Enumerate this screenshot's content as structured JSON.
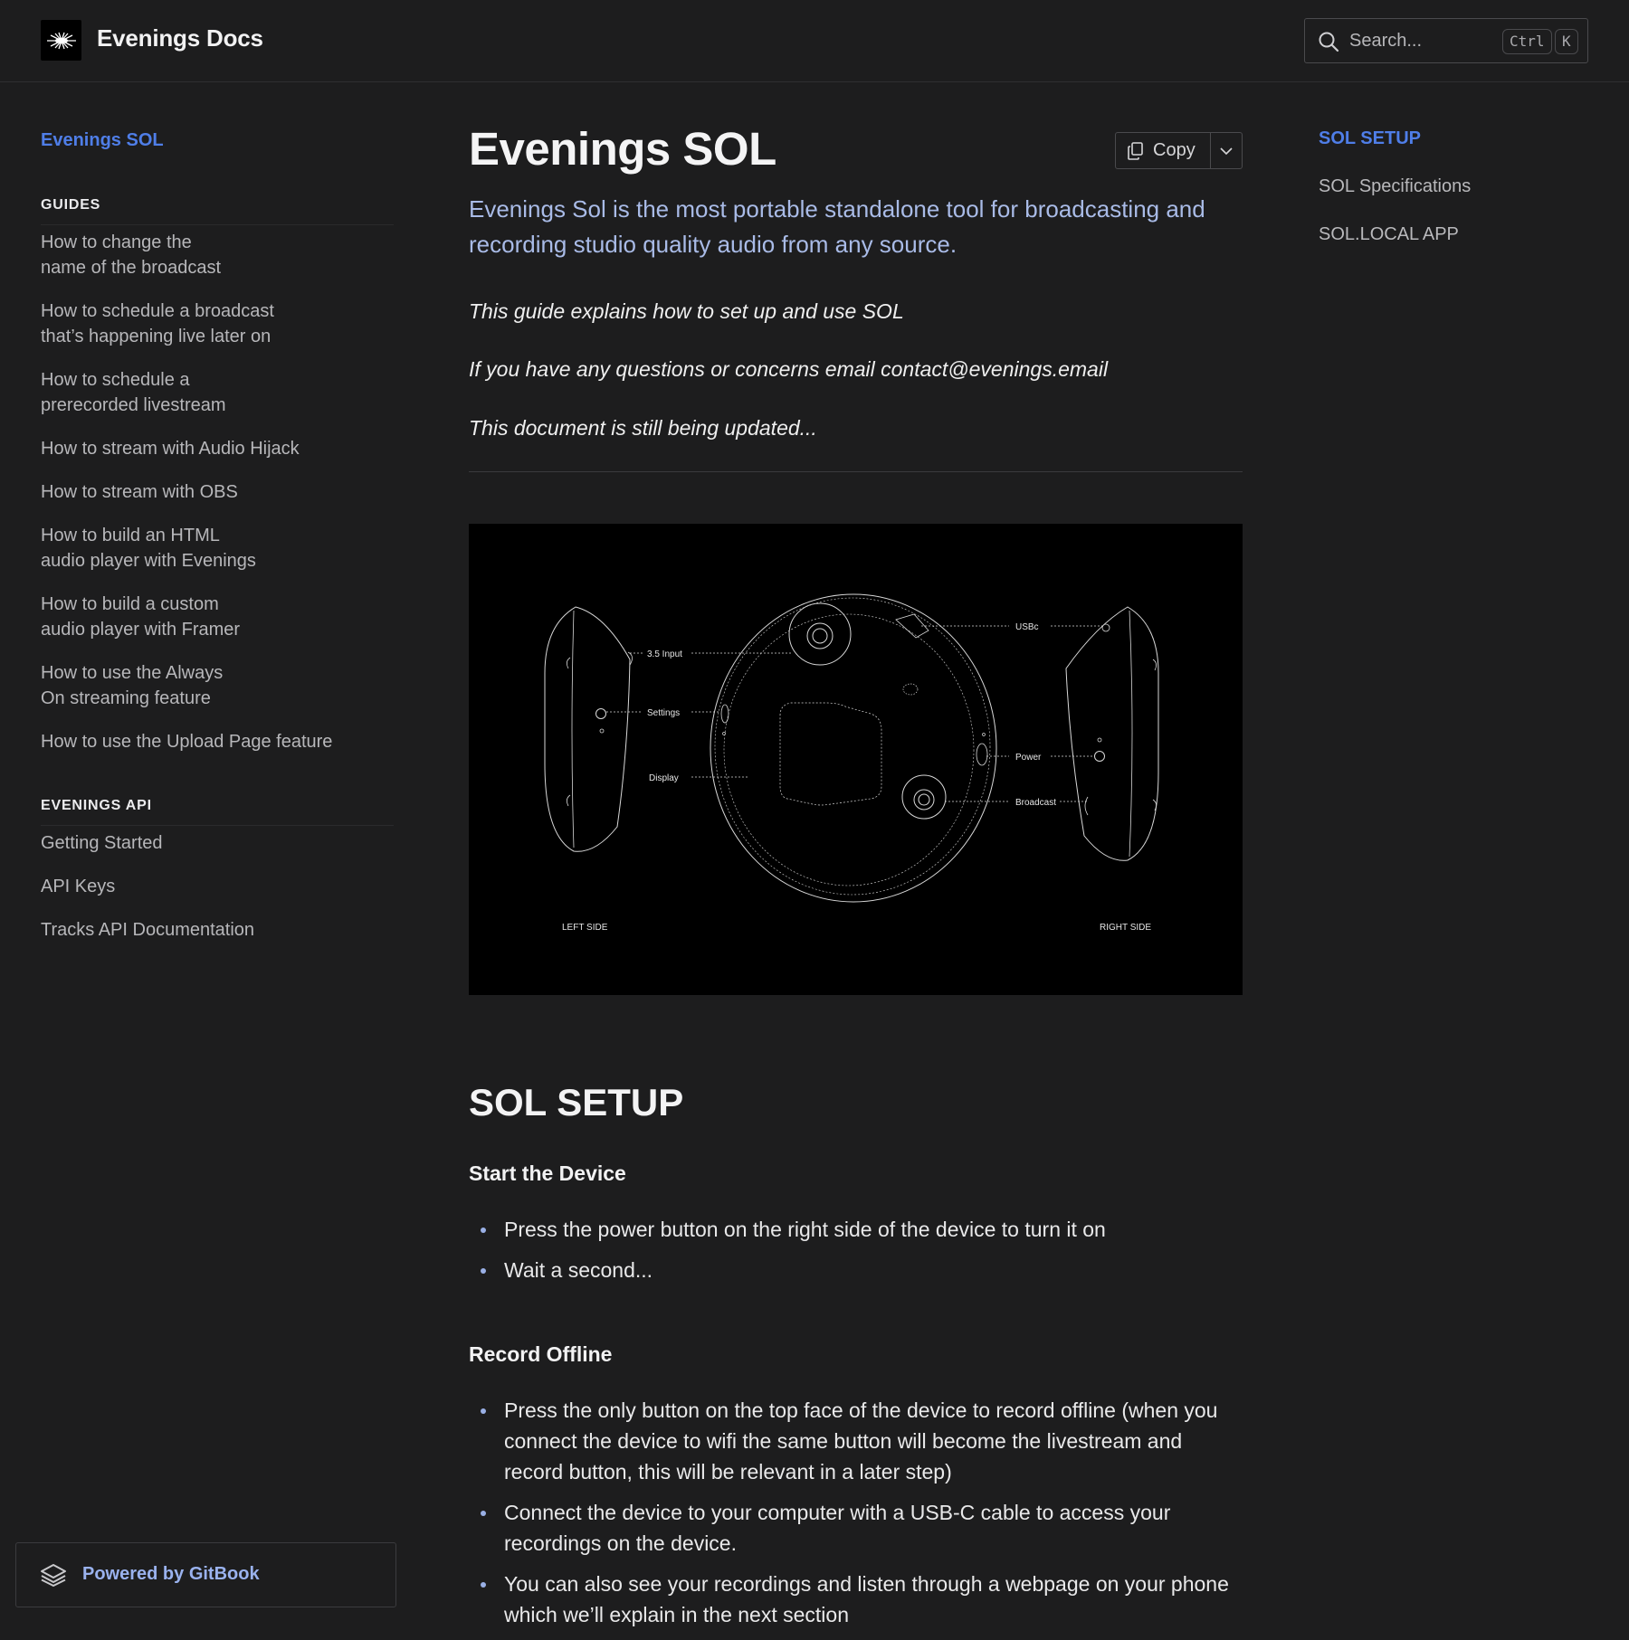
{
  "header": {
    "brand": "Evenings Docs",
    "search_placeholder": "Search...",
    "shortcut_ctrl": "Ctrl",
    "shortcut_key": "K"
  },
  "sidebar": {
    "top_link": "Evenings SOL",
    "guides_heading": "GUIDES",
    "guides": [
      [
        "How to change the",
        "name of the broadcast"
      ],
      [
        "How to schedule a broadcast",
        "that’s happening live later on"
      ],
      [
        "How to schedule a",
        "prerecorded livestream"
      ],
      [
        "How to stream with Audio Hijack"
      ],
      [
        "How to stream with OBS"
      ],
      [
        "How to build an HTML",
        "audio player with Evenings"
      ],
      [
        "How to build a custom",
        "audio player with Framer"
      ],
      [
        "How to use the Always",
        "On streaming feature"
      ],
      [
        "How to use the Upload Page feature"
      ]
    ],
    "api_heading": "EVENINGS API",
    "api": [
      "Getting Started",
      "API Keys",
      "Tracks API Documentation"
    ],
    "powered_by": "Powered by GitBook"
  },
  "main": {
    "title": "Evenings SOL",
    "copy_label": "Copy",
    "lead": "Evenings Sol is the most portable standalone tool for broadcasting and recording studio quality audio from any source.",
    "notes": [
      "This guide explains how to set up and use SOL",
      "If you have any questions or concerns email contact@evenings.email",
      "This document is still being updated..."
    ],
    "diagram": {
      "labels": {
        "input": "3.5 Input",
        "settings": "Settings",
        "display": "Display",
        "usbc": "USBc",
        "power": "Power",
        "broadcast": "Broadcast",
        "left": "LEFT SIDE",
        "right": "RIGHT SIDE"
      }
    },
    "setup_heading": "SOL SETUP",
    "start_heading": "Start the Device",
    "start_bullets": [
      "Press the power button on the right side of the device to turn it on",
      "Wait a second..."
    ],
    "record_heading": "Record Offline",
    "record_bullets": [
      "Press the only button on the top face of the device to record offline (when you connect the device to wifi the same button will become the livestream and record button, this will be relevant in a later step)",
      "Connect the device to your computer with a USB-C cable to access your recordings on the device.",
      "You can also see your recordings and listen through a webpage on your phone which we’ll explain in the next section"
    ]
  },
  "toc": {
    "items": [
      "SOL SETUP",
      "SOL Specifications",
      "SOL.LOCAL APP"
    ]
  },
  "colors": {
    "background": "#1d1d1e",
    "accent": "#4f7ee8",
    "lead_text": "#a9bbe7"
  }
}
